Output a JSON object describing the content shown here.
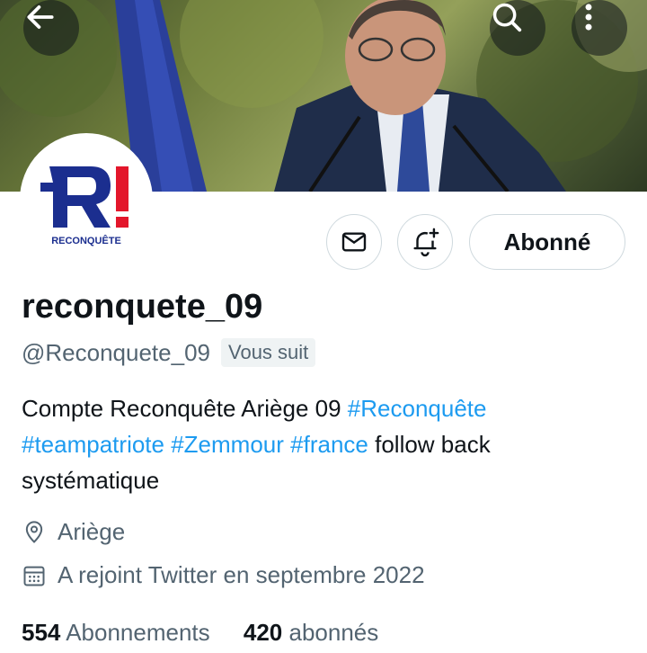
{
  "banner": {
    "back_icon": "arrow-left-icon",
    "search_icon": "search-icon",
    "more_icon": "more-vertical-icon"
  },
  "avatar": {
    "logo_text": "RECONQUÊTE",
    "logo_letter": "R!",
    "colors": {
      "blue": "#1b2e8f",
      "red": "#e3162b"
    }
  },
  "actions": {
    "dm_icon": "envelope-icon",
    "notif_icon": "bell-plus-icon",
    "follow_label": "Abonné"
  },
  "profile": {
    "display_name": "reconquete_09",
    "handle": "@Reconquete_09",
    "follows_you": "Vous suit",
    "bio": {
      "text1": "Compte Reconquête Ariège 09 ",
      "tag1": "#Reconquête",
      "tag2": "#teampatriote",
      "tag3": "#Zemmour",
      "tag4": "#france",
      "text2": " follow back systématique"
    },
    "location": "Ariège",
    "joined": "A rejoint Twitter en septembre 2022"
  },
  "stats": {
    "following_count": "554",
    "following_label": "Abonnements",
    "followers_count": "420",
    "followers_label": "abonnés"
  },
  "colors": {
    "link": "#1d9bf0",
    "muted": "#536471",
    "text": "#0f1419"
  }
}
